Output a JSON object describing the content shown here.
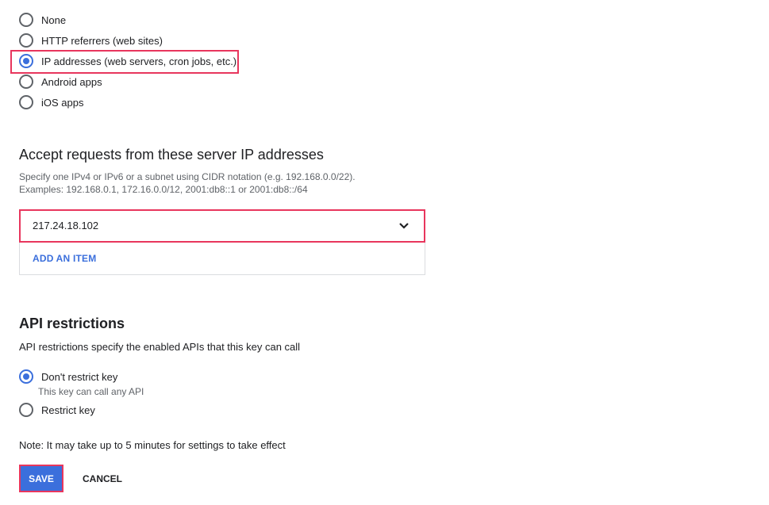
{
  "application_restrictions": {
    "options": [
      {
        "label": "None",
        "checked": false
      },
      {
        "label": "HTTP referrers (web sites)",
        "checked": false
      },
      {
        "label": "IP addresses (web servers, cron jobs, etc.)",
        "checked": true
      },
      {
        "label": "Android apps",
        "checked": false
      },
      {
        "label": "iOS apps",
        "checked": false
      }
    ]
  },
  "ip_section": {
    "title": "Accept requests from these server IP addresses",
    "help_line1": "Specify one IPv4 or IPv6 or a subnet using CIDR notation (e.g. 192.168.0.0/22).",
    "help_line2": "Examples: 192.168.0.1, 172.16.0.0/12, 2001:db8::1 or 2001:db8::/64",
    "items": [
      {
        "value": "217.24.18.102"
      }
    ],
    "add_item_label": "ADD AN ITEM"
  },
  "api_restrictions": {
    "title": "API restrictions",
    "description": "API restrictions specify the enabled APIs that this key can call",
    "options": [
      {
        "label": "Don't restrict key",
        "sublabel": "This key can call any API",
        "checked": true
      },
      {
        "label": "Restrict key",
        "checked": false
      }
    ]
  },
  "note": "Note: It may take up to 5 minutes for settings to take effect",
  "actions": {
    "save_label": "SAVE",
    "cancel_label": "CANCEL"
  },
  "colors": {
    "accent": "#3b6fdc",
    "highlight": "#e8365d"
  }
}
